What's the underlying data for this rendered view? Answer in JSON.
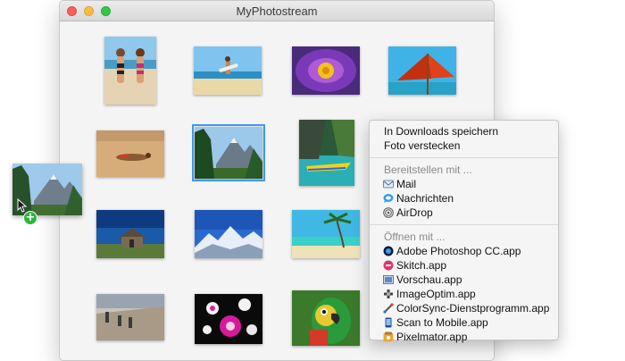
{
  "window": {
    "title": "MyPhotostream"
  },
  "menu": {
    "actions": [
      "In Downloads speichern",
      "Foto verstecken"
    ],
    "share_header": "Bereitstellen mit ...",
    "share": [
      {
        "label": "Mail",
        "icon": "mail-icon"
      },
      {
        "label": "Nachrichten",
        "icon": "messages-icon"
      },
      {
        "label": "AirDrop",
        "icon": "airdrop-icon"
      }
    ],
    "open_header": "Öffnen mit ...",
    "open": [
      {
        "label": "Adobe Photoshop CC.app",
        "icon": "photoshop-icon"
      },
      {
        "label": "Skitch.app",
        "icon": "skitch-icon"
      },
      {
        "label": "Vorschau.app",
        "icon": "preview-icon"
      },
      {
        "label": "ImageOptim.app",
        "icon": "imageoptim-icon"
      },
      {
        "label": "ColorSync-Dienstprogramm.app",
        "icon": "colorsync-icon"
      },
      {
        "label": "Scan to Mobile.app",
        "icon": "scan-to-mobile-icon"
      },
      {
        "label": "Pixelmator.app",
        "icon": "pixelmator-icon"
      }
    ]
  },
  "photos": [
    {
      "subject": "beach-couple-thumbnail",
      "selected": false
    },
    {
      "subject": "surfer-thumbnail",
      "selected": false
    },
    {
      "subject": "flower-purple-thumbnail",
      "selected": false
    },
    {
      "subject": "red-umbrella-thumbnail",
      "selected": false
    },
    {
      "subject": "sunbather-thumbnail",
      "selected": false
    },
    {
      "subject": "mountain-trees-thumbnail",
      "selected": true
    },
    {
      "subject": "kayak-lagoon-thumbnail",
      "selected": false
    },
    {
      "subject": "hut-blue-sky-thumbnail",
      "selected": false
    },
    {
      "subject": "snowy-peaks-thumbnail",
      "selected": false
    },
    {
      "subject": "palm-beach-thumbnail",
      "selected": false
    },
    {
      "subject": "hikers-thumbnail",
      "selected": false
    },
    {
      "subject": "orchids-thumbnail",
      "selected": false
    },
    {
      "subject": "parrot-thumbnail",
      "selected": false
    }
  ],
  "drag_item": {
    "subject": "mountain-trees-thumbnail",
    "badge": "+"
  }
}
